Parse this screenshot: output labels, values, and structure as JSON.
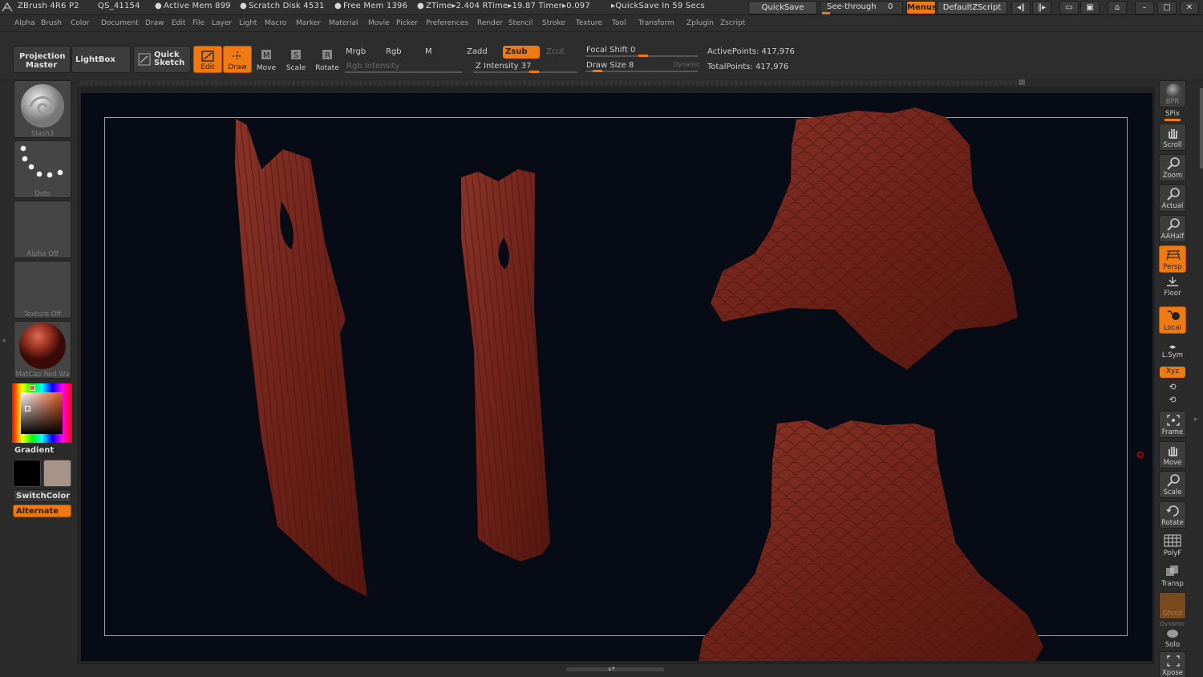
{
  "titlebar": {
    "app": "ZBrush 4R6 P2",
    "doc": "QS_41154",
    "active_mem": "Active Mem 899",
    "scratch": "Scratch Disk 4531",
    "free_mem": "Free Mem 1396",
    "ztime": "ZTime▸2.404 RTime▸19.87 Timer▸0.097",
    "quicksave_status": "▸QuickSave In 59 Secs",
    "quicksave_btn": "QuickSave",
    "seethrough_label": "See-through",
    "seethrough_value": "0",
    "menus_btn": "Menus",
    "script_btn": "DefaultZScript"
  },
  "menus": [
    "Alpha",
    "Brush",
    "Color",
    "Document",
    "Draw",
    "Edit",
    "File",
    "Layer",
    "Light",
    "Macro",
    "Marker",
    "Material",
    "Movie",
    "Picker",
    "Preferences",
    "Render",
    "Stencil",
    "Stroke",
    "Texture",
    "Tool",
    "Transform",
    "Zplugin",
    "Zscript"
  ],
  "shelf": {
    "projection_master": [
      "Projection",
      "Master"
    ],
    "lightbox": "LightBox",
    "quick_sketch": [
      "Quick",
      "Sketch"
    ],
    "tools": {
      "edit": "Edit",
      "draw": "Draw",
      "move": "Move",
      "scale": "Scale",
      "rotate": "Rotate"
    },
    "mrgb": "Mrgb",
    "rgb": "Rgb",
    "m": "M",
    "rgb_intensity": "Rgb Intensity",
    "zadd": "Zadd",
    "zsub": "Zsub",
    "zcut": "Zcut",
    "z_intensity": "Z Intensity 37",
    "focal_shift": "Focal Shift 0",
    "draw_size": "Draw Size 8",
    "dynamic": "Dynamic",
    "active_points": "ActivePoints: 417,976",
    "total_points": "TotalPoints: 417,976"
  },
  "left": {
    "brush": "Slash3",
    "stroke": "Dots",
    "alpha": "Alpha Off",
    "texture": "Texture Off",
    "material": "MatCap Red Wa",
    "gradient": "Gradient",
    "switch": "SwitchColor",
    "alternate": "Alternate"
  },
  "right": {
    "bpr": "BPR",
    "spix": "SPix",
    "scroll": "Scroll",
    "zoom": "Zoom",
    "actual": "Actual",
    "aahalf": "AAHalf",
    "persp": "Persp",
    "floor": "Floor",
    "local": "Local",
    "lsym": "L.Sym",
    "xyz": "Xyz",
    "frame": "Frame",
    "move": "Move",
    "scale": "Scale",
    "rotate": "Rotate",
    "polyf": "PolyF",
    "transp": "Transp",
    "ghost": "Ghost",
    "dynamic": "Dynamic",
    "solo": "Solo",
    "xpose": "Xpose"
  },
  "colors": {
    "accent": "#ef7a12",
    "clay": "#7a2a20",
    "viewport": "#070b15"
  }
}
